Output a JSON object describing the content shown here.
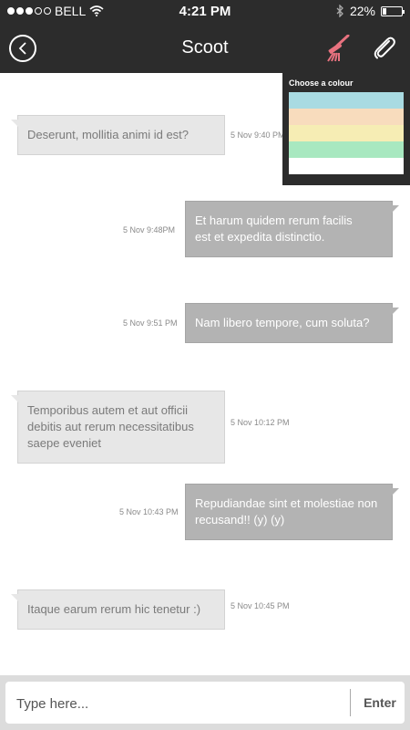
{
  "status_bar": {
    "carrier": "BELL",
    "time": "4:21 PM",
    "battery": "22%",
    "battery_level": 0.22,
    "signal_bars": 3,
    "signal_total": 5,
    "icons": [
      "wifi-icon",
      "bluetooth-icon",
      "battery-icon"
    ]
  },
  "header": {
    "title": "Scoot",
    "icons": [
      "back-arrow-icon",
      "paintbrush-icon",
      "paperclip-icon"
    ]
  },
  "colour_picker": {
    "title": "Choose a colour",
    "swatches": [
      "#a9dbe2",
      "#f8dcbd",
      "#f6edb4",
      "#a8e8c0",
      "#ffffff"
    ]
  },
  "messages": [
    {
      "direction": "in",
      "lines": [
        "Deserunt, mollitia animi id est?"
      ],
      "time": "5 Nov 9:40 PM"
    },
    {
      "direction": "out",
      "lines": [
        "Et harum quidem rerum facilis",
        "est et expedita distinctio."
      ],
      "time": "5 Nov 9:48PM"
    },
    {
      "direction": "out",
      "lines": [
        "Nam libero tempore, cum soluta?"
      ],
      "time": "5 Nov 9:51 PM"
    },
    {
      "direction": "in",
      "lines": [
        "Temporibus autem et aut officii",
        "debitis aut rerum necessitatibus",
        "saepe eveniet"
      ],
      "time": "5 Nov 10:12 PM"
    },
    {
      "direction": "out",
      "lines": [
        "Repudiandae sint et molestiae non",
        "recusand!! (y) (y)"
      ],
      "time": "5 Nov 10:43 PM"
    },
    {
      "direction": "in",
      "lines": [
        "Itaque earum rerum hic tenetur :)"
      ],
      "time": "5 Nov 10:45 PM"
    }
  ],
  "composer": {
    "placeholder": "Type here...",
    "value": "",
    "send_label": "Enter"
  },
  "colors": {
    "bar_background": "#2c2c2c",
    "incoming_bubble": "#e7e7e7",
    "outgoing_bubble": "#b3b3b3",
    "brush_accent": "#e8727f"
  }
}
